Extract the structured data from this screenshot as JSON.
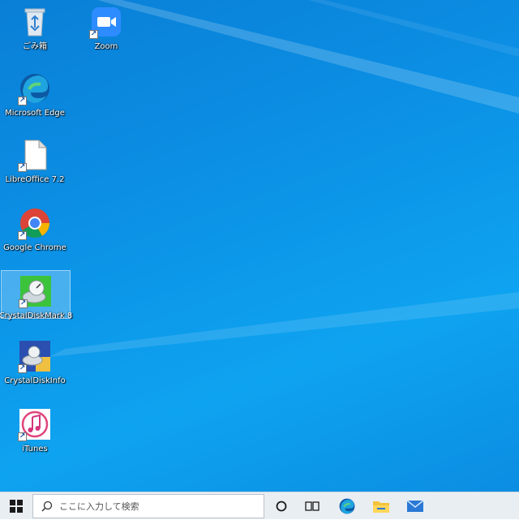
{
  "desktop": {
    "icons": [
      {
        "label": "ごみ箱",
        "icon": "recycle-bin-icon"
      },
      {
        "label": "Zoom",
        "icon": "zoom-icon"
      },
      {
        "label": "Microsoft Edge",
        "icon": "edge-icon"
      },
      {
        "label": "LibreOffice 7.2",
        "icon": "libreoffice-icon"
      },
      {
        "label": "Google Chrome",
        "icon": "chrome-icon"
      },
      {
        "label": "CrystalDiskMark 8",
        "icon": "crystaldiskmark-icon"
      },
      {
        "label": "CrystalDiskInfo",
        "icon": "crystaldiskinfo-icon"
      },
      {
        "label": "iTunes",
        "icon": "itunes-icon"
      }
    ]
  },
  "taskbar": {
    "search_placeholder": "ここに入力して検索",
    "items": [
      "start-icon",
      "search-icon",
      "cortana-icon",
      "task-view-icon",
      "edge-icon",
      "file-explorer-icon",
      "mail-icon"
    ]
  },
  "colors": {
    "desktop": "#0b8fe4",
    "taskbar": "#e9eef3"
  }
}
